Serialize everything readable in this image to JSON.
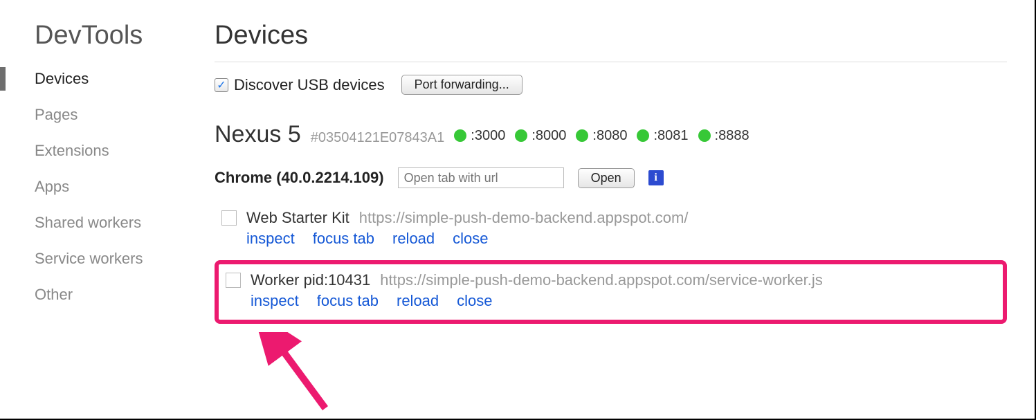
{
  "sidebar": {
    "brand": "DevTools",
    "items": [
      {
        "label": "Devices",
        "active": true
      },
      {
        "label": "Pages"
      },
      {
        "label": "Extensions"
      },
      {
        "label": "Apps"
      },
      {
        "label": "Shared workers"
      },
      {
        "label": "Service workers"
      },
      {
        "label": "Other"
      }
    ]
  },
  "page": {
    "title": "Devices",
    "discover_label": "Discover USB devices",
    "port_forward_label": "Port forwarding..."
  },
  "device": {
    "name": "Nexus 5",
    "id": "#03504121E07843A1",
    "ports": [
      ":3000",
      ":8000",
      ":8080",
      ":8081",
      ":8888"
    ]
  },
  "browser": {
    "name": "Chrome (40.0.2214.109)",
    "open_tab_placeholder": "Open tab with url",
    "open_label": "Open"
  },
  "actions": {
    "inspect": "inspect",
    "focus": "focus tab",
    "reload": "reload",
    "close": "close"
  },
  "tabs": [
    {
      "title": "Web Starter Kit",
      "url": "https://simple-push-demo-backend.appspot.com/",
      "highlight": false
    },
    {
      "title": "Worker pid:10431",
      "url": "https://simple-push-demo-backend.appspot.com/service-worker.js",
      "highlight": true
    }
  ]
}
